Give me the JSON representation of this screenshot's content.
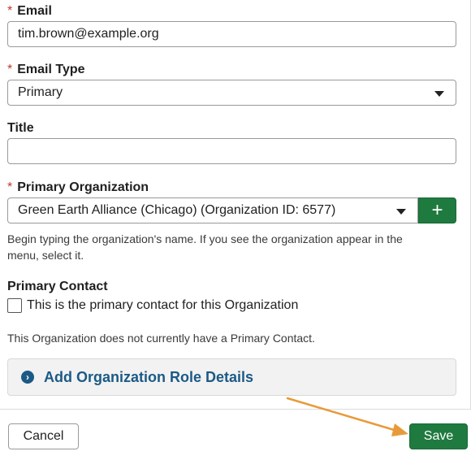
{
  "email": {
    "required_mark": "*",
    "label": "Email",
    "value": "tim.brown@example.org"
  },
  "email_type": {
    "required_mark": "*",
    "label": "Email Type",
    "selected": "Primary"
  },
  "title_field": {
    "label": "Title",
    "value": ""
  },
  "primary_org": {
    "required_mark": "*",
    "label": "Primary Organization",
    "selected": "Green Earth Alliance (Chicago) (Organization ID: 6577)",
    "add_label": "+",
    "help_line1": "Begin typing the organization's name. If you see the organization appear in the",
    "help_line2": "menu, select it."
  },
  "primary_contact": {
    "label": "Primary Contact",
    "checkbox_label": "This is the primary contact for this Organization",
    "checked": false,
    "note": "This Organization does not currently have a Primary Contact."
  },
  "accordion": {
    "icon": "chevron-right-icon",
    "title": "Add Organization Role Details"
  },
  "footer": {
    "cancel_label": "Cancel",
    "save_label": "Save"
  },
  "colors": {
    "accent_green": "#1f7a3f",
    "link_blue": "#1b5a86",
    "required_red": "#c0392b",
    "annotation_arrow": "#e89a3a"
  }
}
